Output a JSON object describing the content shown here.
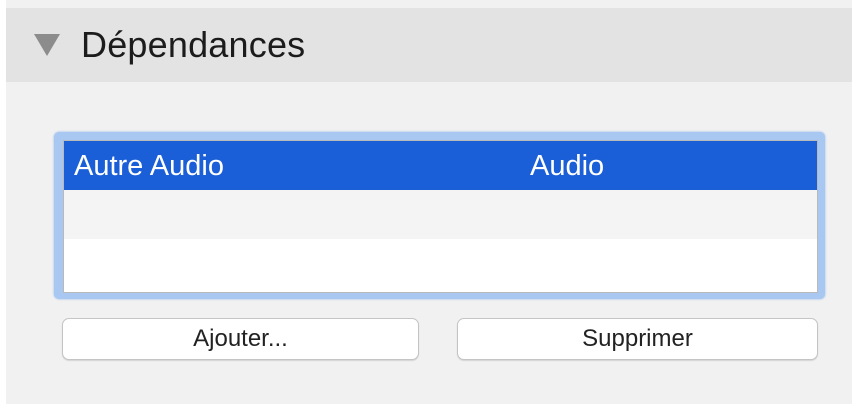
{
  "section": {
    "title": "Dépendances",
    "disclosure_icon": "triangle-down-icon",
    "expanded": true
  },
  "dependencies": {
    "rows": [
      {
        "name": "Autre Audio",
        "type": "Audio",
        "selected": true
      },
      {
        "name": "",
        "type": "",
        "selected": false
      },
      {
        "name": "",
        "type": "",
        "selected": false
      }
    ]
  },
  "buttons": {
    "add_label": "Ajouter...",
    "remove_label": "Supprimer"
  },
  "colors": {
    "selection": "#1a5fd8",
    "focus_ring": "#a8c8f2",
    "header_bg": "#e3e3e3",
    "panel_bg": "#f1f1f1"
  }
}
